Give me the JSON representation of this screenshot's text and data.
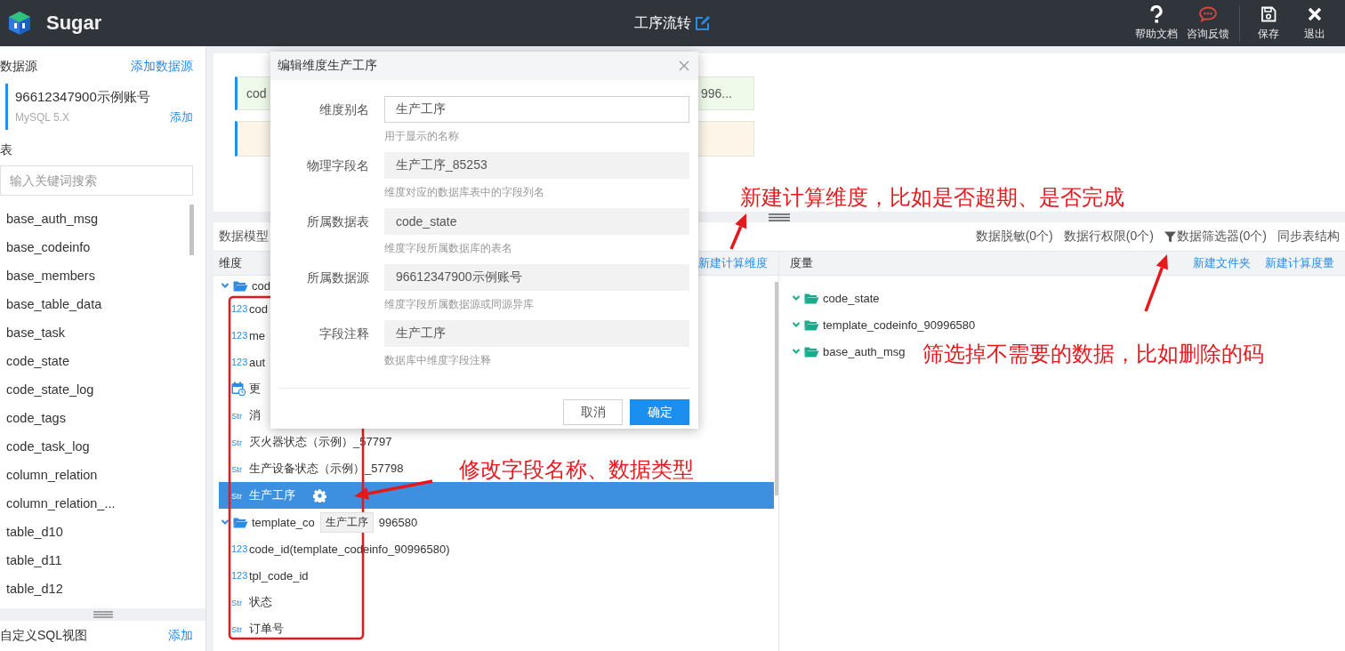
{
  "header": {
    "app_name": "Sugar",
    "title": "工序流转",
    "actions": [
      {
        "label": "帮助文档",
        "kind": "help"
      },
      {
        "label": "咨询反馈",
        "kind": "feedback"
      },
      {
        "label": "保存",
        "kind": "save"
      },
      {
        "label": "退出",
        "kind": "exit"
      }
    ]
  },
  "sidebar": {
    "datasource_heading": "数据源",
    "add_datasource": "添加数据源",
    "datasources": [
      {
        "name": "96612347900示例账号",
        "type": "MySQL 5.X",
        "add": "添加",
        "selected": true
      }
    ],
    "tables_heading": "表",
    "search": {
      "placeholder": "输入关键词搜索"
    },
    "tables": [
      "base_auth_msg",
      "base_codeinfo",
      "base_members",
      "base_table_data",
      "base_task",
      "code_state",
      "code_state_log",
      "code_tags",
      "code_task_log",
      "column_relation",
      "column_relation_...",
      "table_d10",
      "table_d11",
      "table_d12"
    ],
    "sql_view_heading": "自定义SQL视图",
    "sql_view_add": "添加"
  },
  "canvas": {
    "cards": [
      {
        "text_start": "cod",
        "text_end": "996...",
        "color": "#effaea"
      },
      {
        "color": "#fdf5e8"
      }
    ]
  },
  "model": {
    "title": "数据模型",
    "tools": [
      {
        "label": "数据脱敏(0个)",
        "kind": "plain"
      },
      {
        "label": "数据行权限(0个)",
        "kind": "plain"
      },
      {
        "label": "数据筛选器(0个)",
        "kind": "filter"
      },
      {
        "label": "同步表结构",
        "kind": "plain"
      }
    ]
  },
  "dimensions": {
    "heading": "维度",
    "actions": [
      "新建计算维度"
    ],
    "tree": [
      {
        "kind": "folder",
        "label": "cod",
        "expanded": true,
        "children": [
          {
            "kind": "number",
            "type_mark": "123",
            "label": "cod",
            "selected": false
          },
          {
            "kind": "number",
            "type_mark": "123",
            "label": "me",
            "selected": false
          },
          {
            "kind": "number",
            "type_mark": "123",
            "label": "aut",
            "selected": false
          },
          {
            "kind": "date",
            "label": "更",
            "selected": false
          },
          {
            "kind": "string",
            "type_mark": "Str",
            "label": "消",
            "selected": false
          },
          {
            "kind": "string",
            "type_mark": "Str",
            "label": "灭火器状态（示例）_57797",
            "selected": false
          },
          {
            "kind": "string",
            "type_mark": "Str",
            "label": "生产设备状态（示例）_57798",
            "selected": false
          },
          {
            "kind": "string",
            "type_mark": "Str",
            "label": "生产工序",
            "selected": true
          }
        ]
      },
      {
        "kind": "folder",
        "label": "template_co",
        "tooltip": "生产工序",
        "label_end": "996580",
        "expanded": true,
        "children": [
          {
            "kind": "number",
            "type_mark": "123",
            "label": "code_id(template_codeinfo_90996580)",
            "selected": false
          },
          {
            "kind": "number",
            "type_mark": "123",
            "label": "tpl_code_id",
            "selected": false
          },
          {
            "kind": "string",
            "type_mark": "Str",
            "label": "状态",
            "selected": false
          },
          {
            "kind": "string",
            "type_mark": "Str",
            "label": "订单号",
            "selected": false
          }
        ]
      }
    ]
  },
  "measures": {
    "heading": "度量",
    "actions": [
      "新建文件夹",
      "新建计算度量"
    ],
    "tree": [
      {
        "kind": "folder",
        "label": "code_state",
        "expanded": true
      },
      {
        "kind": "folder",
        "label": "template_codeinfo_90996580",
        "expanded": true
      },
      {
        "kind": "folder",
        "label": "base_auth_msg",
        "expanded": true
      }
    ]
  },
  "dialog": {
    "title": "编辑维度生产工序",
    "fields": [
      {
        "label": "维度别名",
        "value": "生产工序",
        "hint": "用于显示的名称",
        "disabled": false
      },
      {
        "label": "物理字段名",
        "value": "生产工序_85253",
        "hint": "维度对应的数据库表中的字段列名",
        "disabled": true
      },
      {
        "label": "所属数据表",
        "value": "code_state",
        "hint": "维度字段所属数据库的表名",
        "disabled": true
      },
      {
        "label": "所属数据源",
        "value": "96612347900示例账号",
        "hint": "维度字段所属数据源或同源异库",
        "disabled": true
      },
      {
        "label": "字段注释",
        "value": "生产工序",
        "hint": "数据库中维度字段注释",
        "disabled": true
      }
    ],
    "buttons": [
      {
        "label": "取消",
        "kind": "secondary"
      },
      {
        "label": "确定",
        "kind": "primary"
      }
    ]
  },
  "annotations": [
    {
      "text": "新建计算维度，比如是否超期、是否完成"
    },
    {
      "text": "修改字段名称、数据类型"
    },
    {
      "text": "筛选掉不需要的数据，比如删除的码"
    }
  ]
}
